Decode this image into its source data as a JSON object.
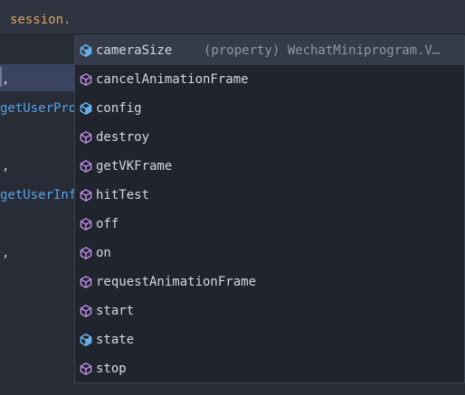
{
  "editor": {
    "line1": {
      "text": "session."
    },
    "left_fragments": [
      {
        "text": ",",
        "color": "plain"
      },
      {
        "text": "getUserPro",
        "color": "blue"
      },
      {
        "text": ",",
        "color": "plain"
      },
      {
        "text": "getUserInf",
        "color": "blue"
      },
      {
        "text": ",",
        "color": "plain"
      }
    ]
  },
  "suggestions": {
    "items": [
      {
        "label": "cameraSize",
        "detail": "(property) WechatMiniprogram.V…",
        "icon": "property-icon",
        "selected": true
      },
      {
        "label": "cancelAnimationFrame",
        "icon": "method-icon"
      },
      {
        "label": "config",
        "icon": "property-icon"
      },
      {
        "label": "destroy",
        "icon": "method-icon"
      },
      {
        "label": "getVKFrame",
        "icon": "method-icon"
      },
      {
        "label": "hitTest",
        "icon": "method-icon"
      },
      {
        "label": "off",
        "icon": "method-icon"
      },
      {
        "label": "on",
        "icon": "method-icon"
      },
      {
        "label": "requestAnimationFrame",
        "icon": "method-icon"
      },
      {
        "label": "start",
        "icon": "method-icon"
      },
      {
        "label": "state",
        "icon": "property-icon"
      },
      {
        "label": "stop",
        "icon": "method-icon"
      }
    ]
  },
  "colors": {
    "property_icon": "#6cb6f0",
    "method_icon": "#c38ee8",
    "keyword_orange": "#d7a65f",
    "identifier_blue": "#5aa2ea"
  }
}
